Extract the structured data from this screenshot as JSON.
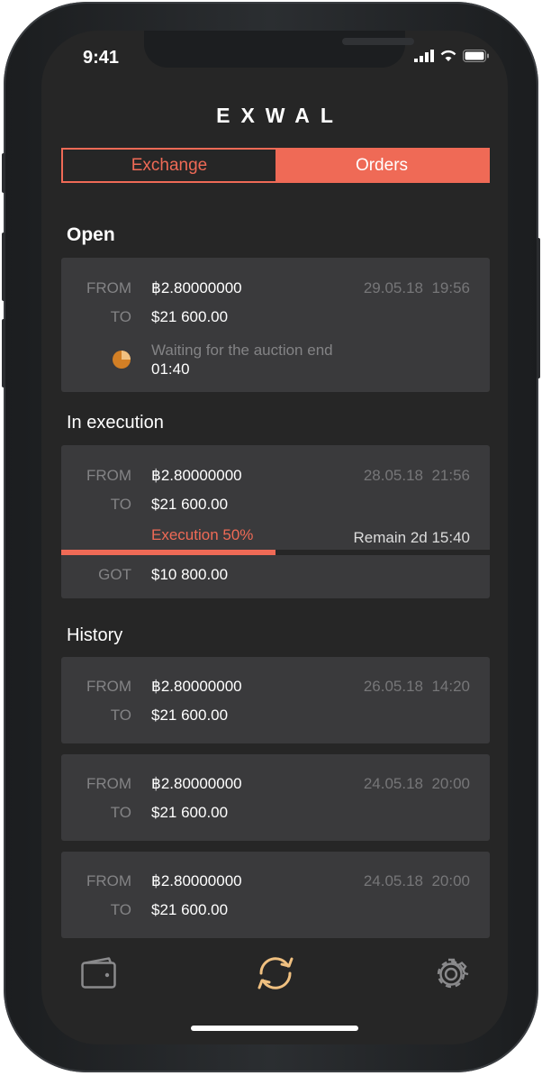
{
  "status_bar": {
    "time": "9:41"
  },
  "app": {
    "logo": "EXWAL"
  },
  "tabs": {
    "exchange": "Exchange",
    "orders": "Orders"
  },
  "colors": {
    "accent": "#ef6a56",
    "nav_active": "#f0c080"
  },
  "open": {
    "title": "Open",
    "order": {
      "from_label": "FROM",
      "from": "฿2.80000000",
      "to_label": "TO",
      "to": "$21 600.00",
      "date": "29.05.18",
      "time": "19:56",
      "waiting_text": "Waiting for the auction end",
      "countdown": "01:40"
    }
  },
  "execution": {
    "title": "In execution",
    "order": {
      "from_label": "FROM",
      "from": "฿2.80000000",
      "to_label": "TO",
      "to": "$21 600.00",
      "date": "28.05.18",
      "time": "21:56",
      "progress_label": "Execution 50%",
      "progress": 0.5,
      "remain": "Remain 2d 15:40",
      "got_label": "GOT",
      "got": "$10 800.00"
    }
  },
  "history": {
    "title": "History",
    "orders": [
      {
        "from_label": "FROM",
        "from": "฿2.80000000",
        "to_label": "TO",
        "to": "$21 600.00",
        "date": "26.05.18",
        "time": "14:20"
      },
      {
        "from_label": "FROM",
        "from": "฿2.80000000",
        "to_label": "TO",
        "to": "$21 600.00",
        "date": "24.05.18",
        "time": "20:00"
      },
      {
        "from_label": "FROM",
        "from": "฿2.80000000",
        "to_label": "TO",
        "to": "$21 600.00",
        "date": "24.05.18",
        "time": "20:00"
      }
    ]
  },
  "nav": {
    "items": [
      "wallet-icon",
      "exchange-icon",
      "settings-icon"
    ],
    "active": "exchange-icon"
  }
}
